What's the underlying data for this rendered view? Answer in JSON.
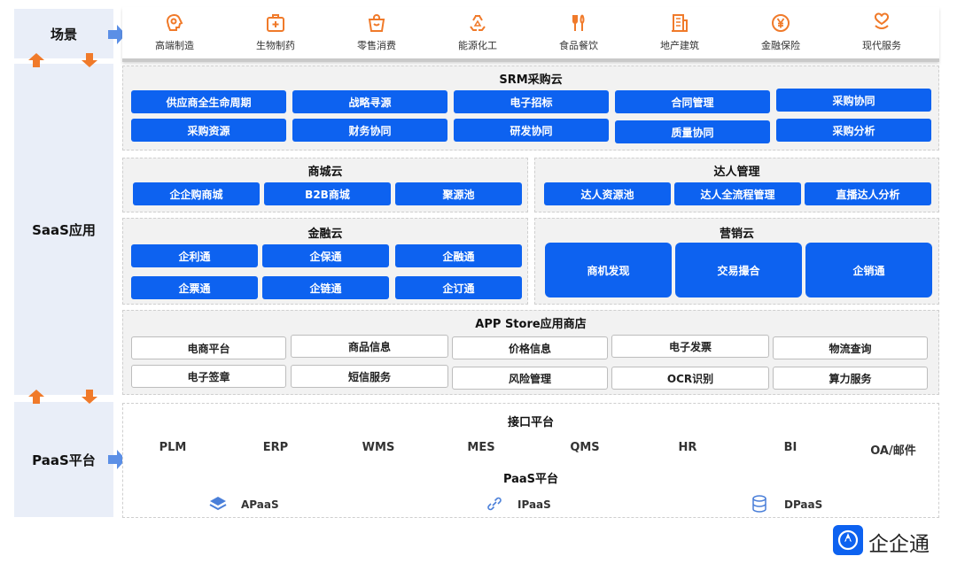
{
  "sidebar": {
    "scene": "场景",
    "saas": "SaaS应用",
    "paas": "PaaS平台"
  },
  "scenes": [
    {
      "label": "高端制造",
      "icon": "brain-gear-icon"
    },
    {
      "label": "生物制药",
      "icon": "medkit-icon"
    },
    {
      "label": "零售消费",
      "icon": "shopping-bag-icon"
    },
    {
      "label": "能源化工",
      "icon": "recycle-icon"
    },
    {
      "label": "食品餐饮",
      "icon": "fork-knife-icon"
    },
    {
      "label": "地产建筑",
      "icon": "building-icon"
    },
    {
      "label": "金融保险",
      "icon": "yen-coin-icon"
    },
    {
      "label": "现代服务",
      "icon": "heart-hand-icon"
    }
  ],
  "srm": {
    "title": "SRM采购云",
    "row1": [
      "供应商全生命周期",
      "战略寻源",
      "电子招标",
      "合同管理",
      "采购协同"
    ],
    "row2": [
      "采购资源",
      "财务协同",
      "研发协同",
      "质量协同",
      "采购分析"
    ]
  },
  "mall": {
    "title": "商城云",
    "items": [
      "企企购商城",
      "B2B商城",
      "聚源池"
    ]
  },
  "talent": {
    "title": "达人管理",
    "items": [
      "达人资源池",
      "达人全流程管理",
      "直播达人分析"
    ]
  },
  "finance": {
    "title": "金融云",
    "row1": [
      "企利通",
      "企保通",
      "企融通"
    ],
    "row2": [
      "企票通",
      "企链通",
      "企订通"
    ]
  },
  "marketing": {
    "title": "营销云",
    "items": [
      "商机发现",
      "交易撮合",
      "企销通"
    ]
  },
  "appstore": {
    "title": "APP Store应用商店",
    "row1": [
      "电商平台",
      "商品信息",
      "价格信息",
      "电子发票",
      "物流查询"
    ],
    "row2": [
      "电子签章",
      "短信服务",
      "风险管理",
      "OCR识别",
      "算力服务"
    ]
  },
  "paas": {
    "interface_title": "接口平台",
    "interfaces": [
      "PLM",
      "ERP",
      "WMS",
      "MES",
      "QMS",
      "HR",
      "BI",
      "OA/邮件"
    ],
    "platform_title": "PaaS平台",
    "platforms": [
      {
        "label": "APaaS",
        "icon": "layers-icon"
      },
      {
        "label": "IPaaS",
        "icon": "link-icon"
      },
      {
        "label": "DPaaS",
        "icon": "database-icon"
      }
    ]
  },
  "brand": {
    "name": "企企通",
    "icon": "compass-logo-icon"
  },
  "colors": {
    "primary": "#0d62f0",
    "accent_orange": "#f07a2a",
    "side_bg": "#e9eef8"
  }
}
